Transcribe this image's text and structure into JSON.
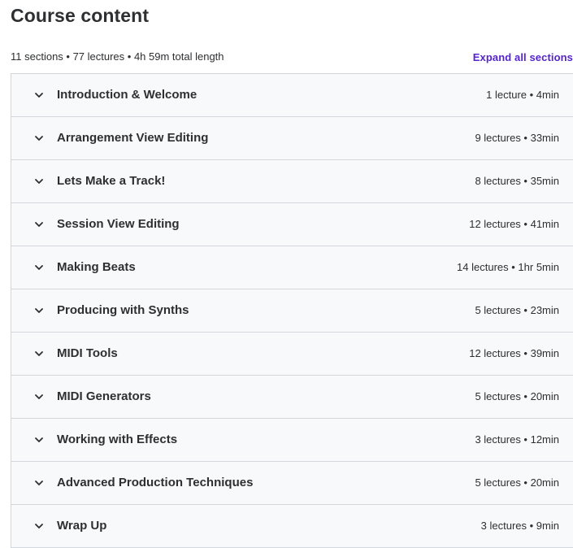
{
  "header": {
    "title": "Course content",
    "summary": "11 sections • 77 lectures • 4h 59m total length",
    "expand_all_label": "Expand all sections"
  },
  "sections": [
    {
      "title": "Introduction & Welcome",
      "info": "1 lecture • 4min",
      "icon": "chevron-down-icon"
    },
    {
      "title": "Arrangement View Editing",
      "info": "9 lectures • 33min",
      "icon": "chevron-down-icon"
    },
    {
      "title": "Lets Make a Track!",
      "info": "8 lectures • 35min",
      "icon": "chevron-down-icon"
    },
    {
      "title": "Session View Editing",
      "info": "12 lectures • 41min",
      "icon": "chevron-down-icon"
    },
    {
      "title": "Making Beats",
      "info": "14 lectures • 1hr 5min",
      "icon": "chevron-down-icon"
    },
    {
      "title": "Producing with Synths",
      "info": "5 lectures • 23min",
      "icon": "chevron-down-icon"
    },
    {
      "title": "MIDI Tools",
      "info": "12 lectures • 39min",
      "icon": "chevron-down-icon"
    },
    {
      "title": "MIDI Generators",
      "info": "5 lectures • 20min",
      "icon": "chevron-down-icon"
    },
    {
      "title": "Working with Effects",
      "info": "3 lectures • 12min",
      "icon": "chevron-down-icon"
    },
    {
      "title": "Advanced Production Techniques",
      "info": "5 lectures • 20min",
      "icon": "chevron-down-icon"
    },
    {
      "title": "Wrap Up",
      "info": "3 lectures • 9min",
      "icon": "chevron-down-icon"
    }
  ],
  "colors": {
    "accent": "#5624d0",
    "text": "#2d2f31",
    "section_bg": "#f7f9fa",
    "border": "#d1d7dc"
  }
}
